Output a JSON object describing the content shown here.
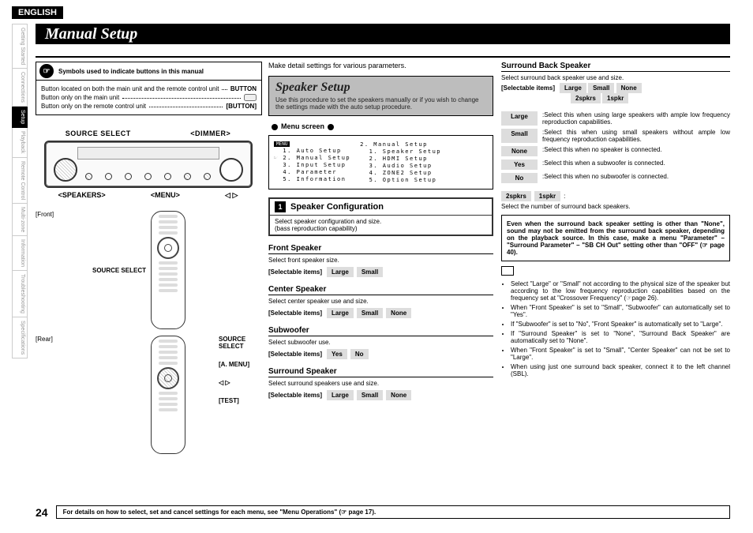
{
  "lang": "ENGLISH",
  "title": "Manual Setup",
  "tabs": [
    "Getting Started",
    "Connections",
    "Setup",
    "Playback",
    "Remote Control",
    "Multi-zone",
    "Information",
    "Troubleshooting",
    "Specifications"
  ],
  "active_tab": 2,
  "symbols": {
    "header": "Symbols used to indicate buttons in this manual",
    "rows": [
      {
        "l": "Button located on both the main unit and the remote control unit",
        "r": "BUTTON"
      },
      {
        "l": "Button only on the main unit",
        "r": "<BUTTON>"
      },
      {
        "l": "Button only on the remote control unit",
        "r": "[BUTTON]"
      }
    ]
  },
  "dev": {
    "top": [
      "SOURCE SELECT",
      "<DIMMER>"
    ],
    "bottom": [
      "<SPEAKERS>",
      "<MENU>",
      "◁ ▷"
    ]
  },
  "remote": {
    "front": "[Front]",
    "rear": "[Rear]",
    "labels": [
      "SOURCE SELECT",
      "SOURCE SELECT",
      "[A. MENU]",
      "◁ ▷",
      "[TEST]"
    ]
  },
  "col2": {
    "intro": "Make detail settings for various parameters.",
    "heading": "Speaker Setup",
    "heading_sub": "Use this procedure to set the speakers manually or if you wish to change the settings made with the auto setup procedure.",
    "menu_label": "Menu screen",
    "menu_left": [
      "1. Auto Setup",
      "2. Manual Setup",
      "3. Input Setup",
      "4. Parameter",
      "5. Information"
    ],
    "menu_right": [
      "2. Manual Setup",
      "1. Speaker Setup",
      "2. HDMI Setup",
      "3. Audio Setup",
      "4. ZONE2 Setup",
      "5. Option Setup"
    ],
    "conf_num": "1",
    "conf_title": "Speaker Configuration",
    "conf_body1": "Select speaker configuration and size.",
    "conf_body2": "(bass reproduction capability)",
    "subs": [
      {
        "t": "Front Speaker",
        "d": "Select front speaker size.",
        "items": [
          "Large",
          "Small"
        ]
      },
      {
        "t": "Center Speaker",
        "d": "Select center speaker use and size.",
        "items": [
          "Large",
          "Small",
          "None"
        ]
      },
      {
        "t": "Subwoofer",
        "d": "Select subwoofer use.",
        "items": [
          "Yes",
          "No"
        ]
      },
      {
        "t": "Surround Speaker",
        "d": "Select surround speakers use and size.",
        "items": [
          "Large",
          "Small",
          "None"
        ]
      }
    ],
    "sel_label": "[Selectable items]"
  },
  "col3": {
    "sbs": {
      "t": "Surround Back Speaker",
      "d": "Select surround back speaker use and size.",
      "row1": [
        "Large",
        "Small",
        "None"
      ],
      "row2": [
        "2spkrs",
        "1spkr"
      ]
    },
    "desc": [
      {
        "k": "Large",
        "v": ":Select this when using large speakers with ample low frequency reproduction capabilities."
      },
      {
        "k": "Small",
        "v": ":Select this when using small speakers without ample low frequency reproduction capabilities."
      },
      {
        "k": "None",
        "v": ":Select this when no speaker is connected."
      },
      {
        "k": "Yes",
        "v": ":Select this when a subwoofer is connected."
      },
      {
        "k": "No",
        "v": ":Select this when no subwoofer is connected."
      }
    ],
    "sp_pair": [
      "2spkrs",
      "1spkr"
    ],
    "sp_colon": ":",
    "sp_text": "Select the number of surround back speakers.",
    "note": "Even when the surround back speaker setting is other than \"None\", sound may not be emitted from the surround back speaker, depending on the playback source. In this case, make a menu \"Parameter\" – \"Surround Parameter\" – \"SB CH Out\" setting other than \"OFF\" (☞ page 40).",
    "bullets": [
      "Select \"Large\" or \"Small\" not according to the physical size of the speaker but according to the low frequency reproduction capabilities based on the frequency set at \"Crossover Frequency\" (☞page 26).",
      "When \"Front Speaker\" is set to \"Small\", \"Subwoofer\" can automatically set to \"Yes\".",
      "If \"Subwoofer\" is set to \"No\", \"Front Speaker\" is automatically set to \"Large\".",
      "If \"Surround Speaker\" is set to \"None\", \"Surround Back Speaker\" are automatically set to \"None\".",
      "When \"Front Speaker\" is set to \"Small\", \"Center Speaker\" can not be set to \"Large\".",
      "When using just one surround back speaker, connect it to the left channel (SBL)."
    ]
  },
  "footer": {
    "page": "24",
    "text": "For details on how to select, set and cancel settings for each menu, see \"Menu Operations\" (☞ page 17)."
  }
}
